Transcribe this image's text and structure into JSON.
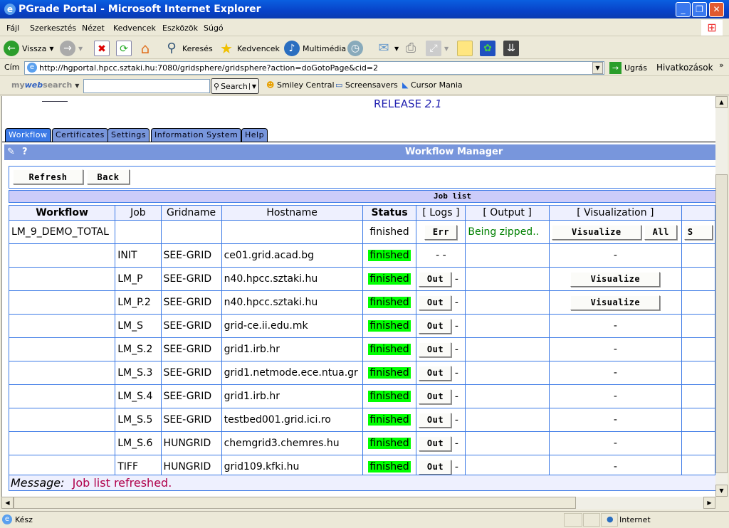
{
  "window": {
    "title": "PGrade Portal - Microsoft Internet Explorer"
  },
  "menu": [
    "Fájl",
    "Szerkesztés",
    "Nézet",
    "Kedvencek",
    "Eszközök",
    "Súgó"
  ],
  "toolbar": {
    "back": "Vissza",
    "search": "Keresés",
    "favorites": "Kedvencek",
    "media": "Multimédia"
  },
  "address": {
    "label": "Cím",
    "url": "http://hgportal.hpcc.sztaki.hu:7080/gridsphere/gridsphere?action=doGotoPage&cid=2",
    "go": "Ugrás",
    "links": "Hivatkozások"
  },
  "websearch": {
    "brand_my": "my",
    "brand_web": "web",
    "brand_search": "search",
    "search_button": "Search",
    "smiley": "Smiley Central",
    "screensavers": "Screensavers",
    "cursor": "Cursor Mania"
  },
  "page": {
    "release": "RELEASE",
    "version": "2.1",
    "tabs": [
      "Workflow",
      "Certificates",
      "Settings",
      "Information System",
      "Help"
    ],
    "portlet_title": "Workflow Manager",
    "help": "?",
    "refresh": "Refresh",
    "back": "Back",
    "joblist_title": "Job list",
    "columns": [
      "Workflow",
      "Job",
      "Gridname",
      "Hostname",
      "Status",
      "[ Logs ]",
      "[ Output ]",
      "[ Visualization ]"
    ],
    "workflow_row": {
      "name": "LM_9_DEMO_TOTAL",
      "status": "finished",
      "log_button": "Err",
      "output": "Being zipped..",
      "visualize": "Visualize",
      "all": "All",
      "extra": "S"
    },
    "jobs": [
      {
        "job": "INIT",
        "grid": "SEE-GRID",
        "host": "ce01.grid.acad.bg",
        "status": "finished",
        "log": "- -",
        "vis": "-"
      },
      {
        "job": "LM_P",
        "grid": "SEE-GRID",
        "host": "n40.hpcc.sztaki.hu",
        "status": "finished",
        "log": "Out",
        "vis": "Visualize"
      },
      {
        "job": "LM_P.2",
        "grid": "SEE-GRID",
        "host": "n40.hpcc.sztaki.hu",
        "status": "finished",
        "log": "Out",
        "vis": "Visualize"
      },
      {
        "job": "LM_S",
        "grid": "SEE-GRID",
        "host": "grid-ce.ii.edu.mk",
        "status": "finished",
        "log": "Out",
        "vis": "-"
      },
      {
        "job": "LM_S.2",
        "grid": "SEE-GRID",
        "host": "grid1.irb.hr",
        "status": "finished",
        "log": "Out",
        "vis": "-"
      },
      {
        "job": "LM_S.3",
        "grid": "SEE-GRID",
        "host": "grid1.netmode.ece.ntua.gr",
        "status": "finished",
        "log": "Out",
        "vis": "-"
      },
      {
        "job": "LM_S.4",
        "grid": "SEE-GRID",
        "host": "grid1.irb.hr",
        "status": "finished",
        "log": "Out",
        "vis": "-"
      },
      {
        "job": "LM_S.5",
        "grid": "SEE-GRID",
        "host": "testbed001.grid.ici.ro",
        "status": "finished",
        "log": "Out",
        "vis": "-"
      },
      {
        "job": "LM_S.6",
        "grid": "HUNGRID",
        "host": "chemgrid3.chemres.hu",
        "status": "finished",
        "log": "Out",
        "vis": "-"
      },
      {
        "job": "TIFF",
        "grid": "HUNGRID",
        "host": "grid109.kfki.hu",
        "status": "finished",
        "log": "Out",
        "vis": "-"
      }
    ],
    "dash": "-",
    "message_label": "Message:",
    "message": "Job list refreshed."
  },
  "statusbar": {
    "text": "Kész",
    "zone": "Internet"
  },
  "colors": {
    "finished": "#00ff00",
    "tab": "#7896dc",
    "border": "#3c7ae6",
    "message": "#b0004a",
    "output": "#008000"
  }
}
